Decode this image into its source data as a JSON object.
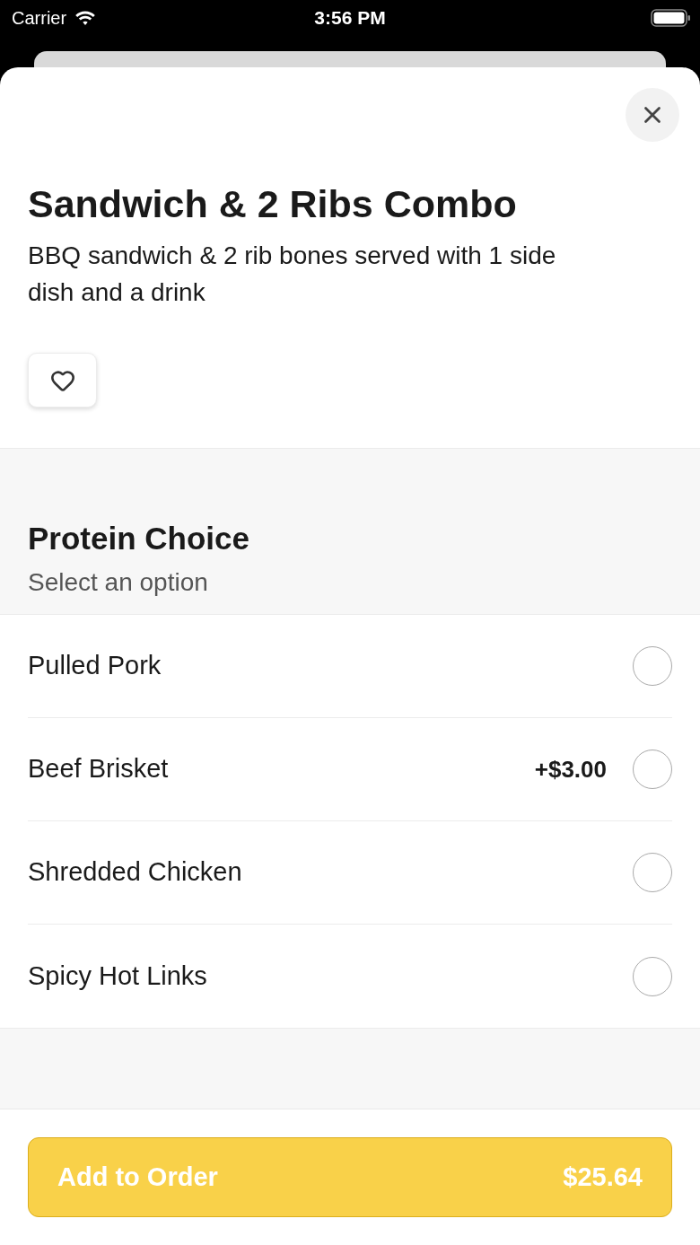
{
  "status_bar": {
    "carrier": "Carrier",
    "time": "3:56 PM"
  },
  "item": {
    "title": "Sandwich & 2 Ribs Combo",
    "description": "BBQ sandwich & 2 rib bones served with 1 side dish and a drink",
    "favorite": false
  },
  "sections": [
    {
      "title": "Protein Choice",
      "subtitle": "Select an option",
      "options": [
        {
          "label": "Pulled Pork",
          "selected": false
        },
        {
          "label": "Beef Brisket",
          "price": "+$3.00",
          "selected": false
        },
        {
          "label": "Shredded Chicken",
          "selected": false
        },
        {
          "label": "Spicy Hot Links",
          "selected": false
        }
      ]
    }
  ],
  "add_button": {
    "label": "Add to Order",
    "price": "$25.64"
  }
}
